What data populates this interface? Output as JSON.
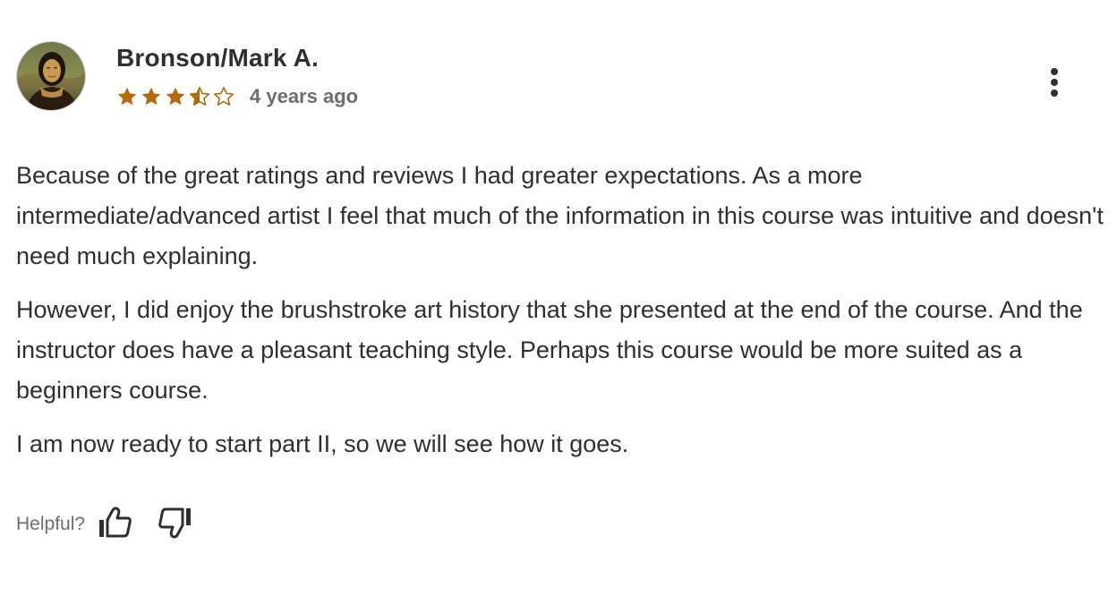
{
  "review": {
    "reviewer_name": "Bronson/Mark A.",
    "rating": 3.5,
    "rating_max": 5,
    "timestamp": "4 years ago",
    "paragraphs": [
      "Because of the great ratings and reviews I had greater expectations. As a more intermediate/advanced artist I feel that much of the information in this course was intuitive and doesn't need much explaining.",
      "However, I did enjoy the brushstroke art history that she presented at the end of the course. And the instructor does have a pleasant teaching style. Perhaps this course would be more suited as a beginners course.",
      "I am now ready to start part II, so we will see how it goes."
    ],
    "helpful_label": "Helpful?"
  },
  "icons": {
    "more": "more-vertical-icon",
    "thumb_up": "thumbs-up-icon",
    "thumb_down": "thumbs-down-icon",
    "star": "star-icon"
  },
  "colors": {
    "star": "#b4690e",
    "text": "#2d2f31",
    "muted": "#6a6f73"
  }
}
